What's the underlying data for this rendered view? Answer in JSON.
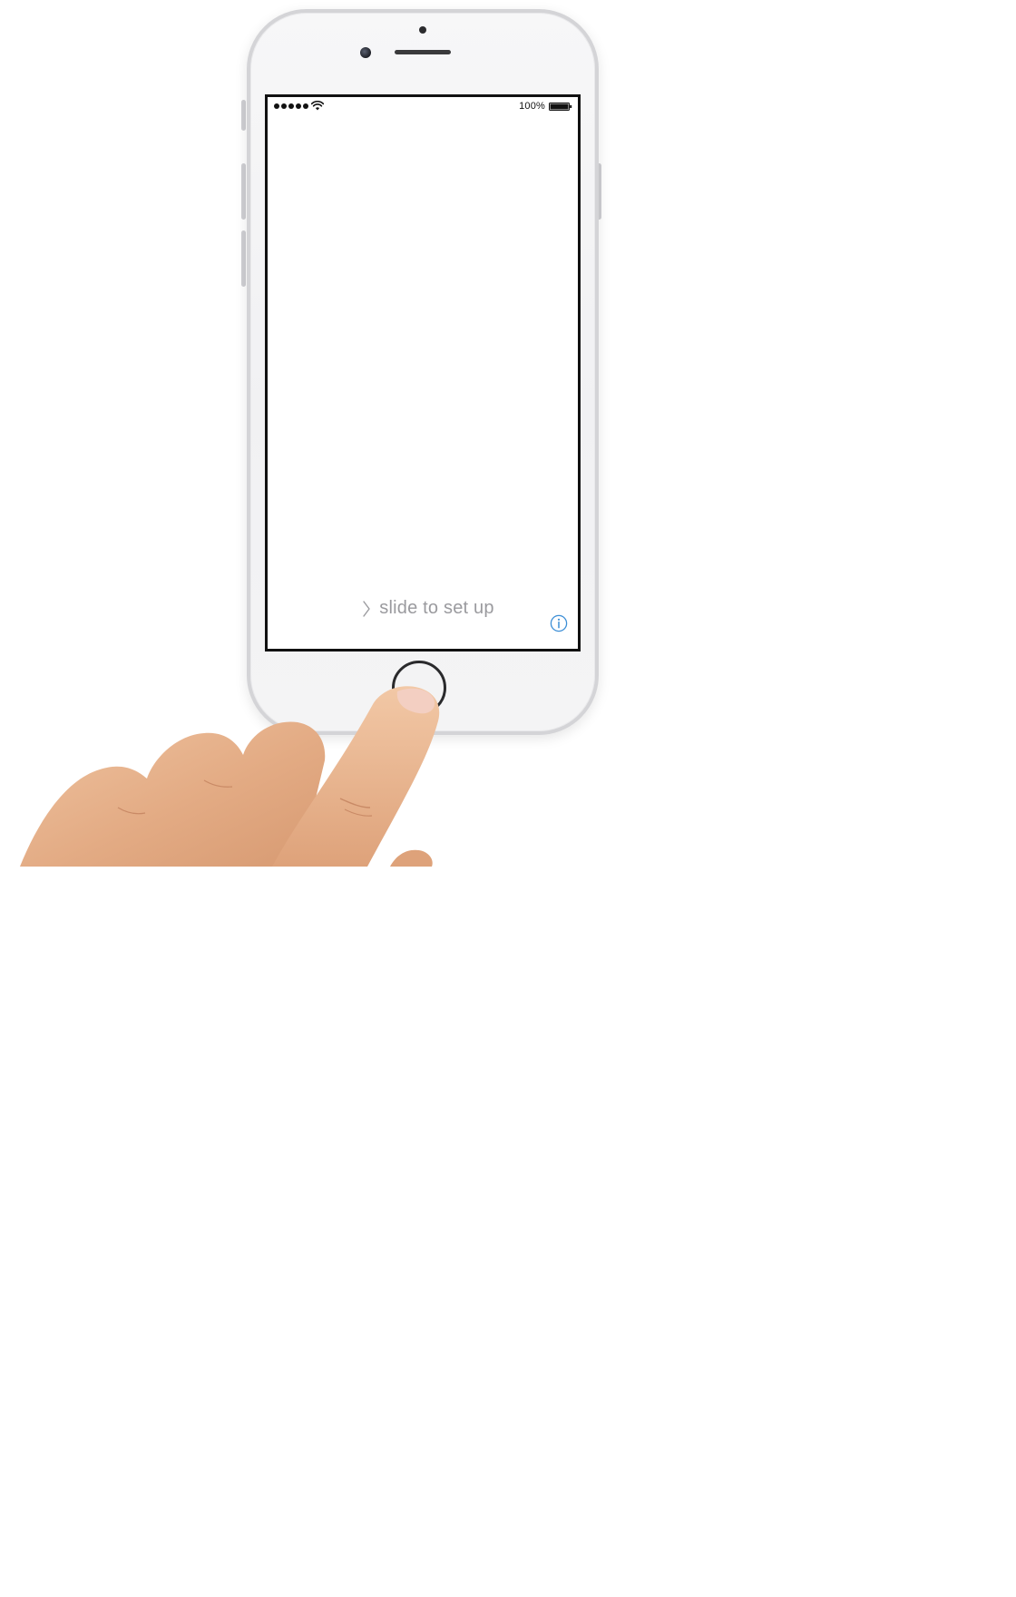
{
  "status_bar": {
    "signal_bars": 5,
    "battery_percent": "100%",
    "battery_level": 1.0
  },
  "screen": {
    "slide_text": "slide to set up"
  },
  "icons": {
    "chevron": "chevron-right-icon",
    "info": "info-icon",
    "wifi": "wifi-icon",
    "battery": "battery-icon"
  },
  "colors": {
    "phone_body": "#f4f4f5",
    "phone_edge": "#d4d4d7",
    "slide_text": "#9a9a9e",
    "info_accent": "#3d8fd6",
    "skin": "#e8b591"
  }
}
